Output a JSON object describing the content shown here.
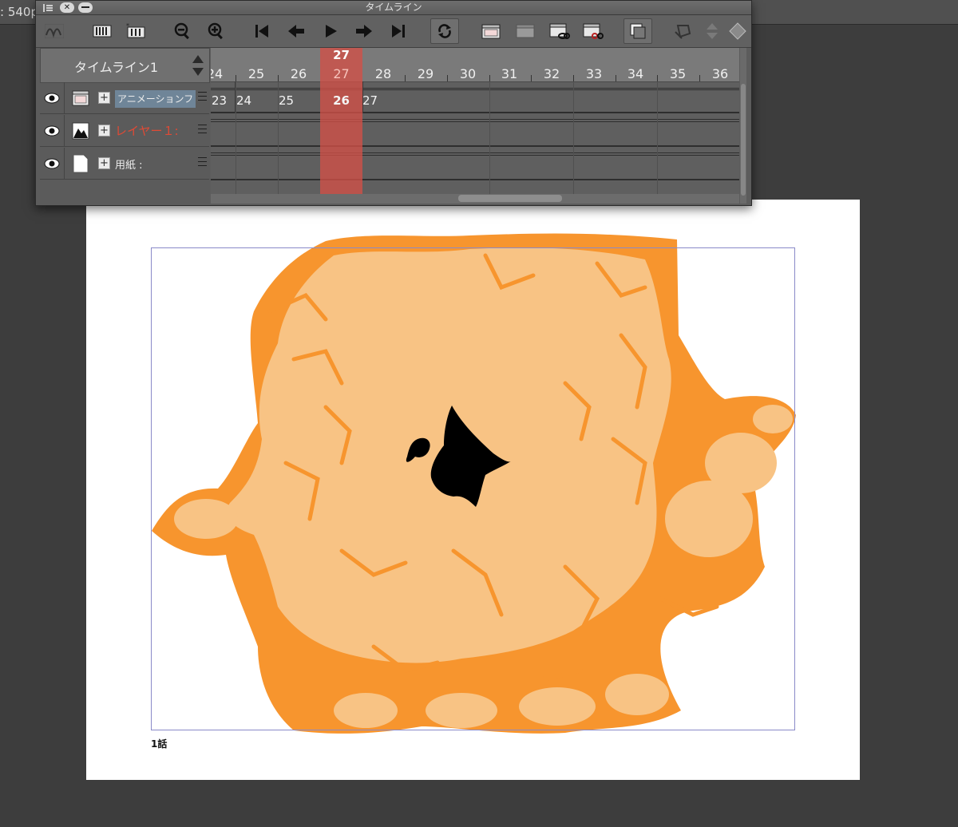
{
  "top_strip": {
    "zoom_readout": ": 540p"
  },
  "timeline_window": {
    "title": "タイムライン",
    "timeline_name": "タイムライン1",
    "current_frame": "27",
    "ruler_frames": [
      "24",
      "25",
      "26",
      "27",
      "28",
      "29",
      "30",
      "31",
      "32",
      "33",
      "34",
      "35",
      "36"
    ],
    "toolbar": {
      "tools": [
        "wave-icon",
        "new-frame-icon",
        "new-frame-left-icon",
        "zoom-out-icon",
        "zoom-in-icon",
        "first-frame-icon",
        "previous-frame-icon",
        "play-icon",
        "next-frame-icon",
        "last-frame-icon",
        "loop-icon",
        "new-animation-folder-icon",
        "folder-icon",
        "link-cel-icon",
        "unlink-cel-icon",
        "layer-mask-icon",
        "rotate-icon",
        "up-down-icon",
        "diamond-icon"
      ]
    },
    "layers": [
      {
        "name": "アニメーションフ",
        "type": "animation-folder",
        "cels": [
          "23",
          "24",
          "25",
          "26",
          "27"
        ]
      },
      {
        "name": "レイヤー１:",
        "type": "raster",
        "cels": []
      },
      {
        "name": "用紙 :",
        "type": "paper",
        "cels": []
      }
    ]
  },
  "canvas": {
    "episode_label": "1話",
    "colors": {
      "paper": "#ffffff",
      "fire_light": "#f8c384",
      "fire_dark": "#f7952e",
      "ink": "#000000",
      "frame_border": "#8a8ac8"
    }
  }
}
